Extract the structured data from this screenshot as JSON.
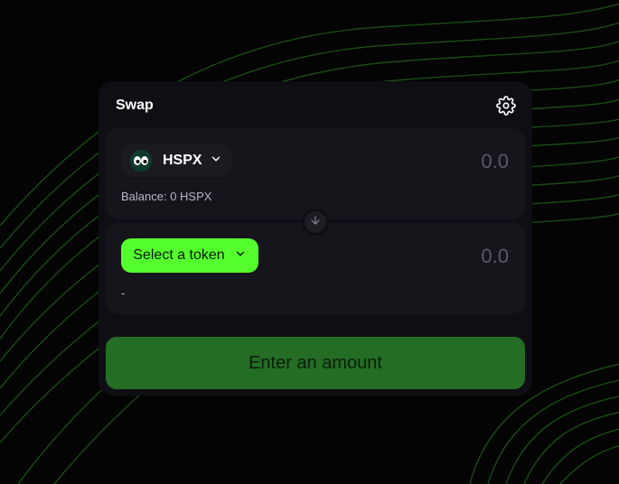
{
  "swap": {
    "title": "Swap",
    "settings_icon": "gear-icon",
    "from": {
      "token_symbol": "HSPX",
      "token_icon": "hspx-eyes-icon",
      "amount": "0.0",
      "balance": "Balance: 0 HSPX"
    },
    "switch_icon": "arrow-down-icon",
    "to": {
      "select_label": "Select a token",
      "amount": "0.0",
      "balance": "-"
    },
    "submit_label": "Enter an amount"
  },
  "colors": {
    "accent": "#55ff2e",
    "cta_background": "#246d25",
    "card_background": "#0f0e14",
    "panel_background": "#16151c"
  }
}
